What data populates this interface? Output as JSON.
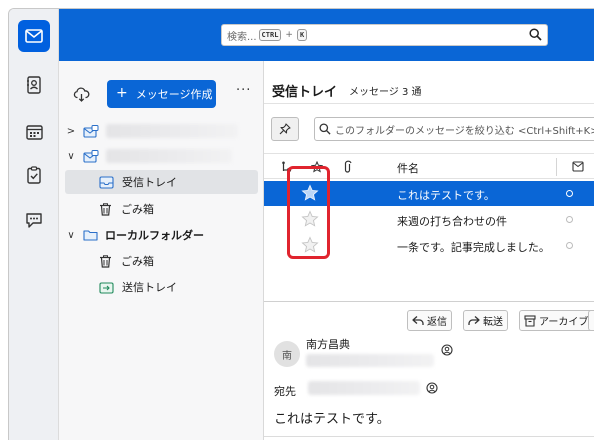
{
  "search": {
    "placeholder": "検索...",
    "key1": "CTRL",
    "plus": "+",
    "key2": "K"
  },
  "folder_pane": {
    "compose_label": "メッセージ作成",
    "folders": [
      {
        "label": "受信トレイ"
      },
      {
        "label": "ごみ箱"
      },
      {
        "label": "ローカルフォルダー"
      },
      {
        "label": "ごみ箱"
      },
      {
        "label": "送信トレイ"
      }
    ]
  },
  "message_list": {
    "title": "受信トレイ",
    "count": "メッセージ 3 通",
    "filter_placeholder": "このフォルダーのメッセージを絞り込む <Ctrl+Shift+K>",
    "subject_header": "件名",
    "rows": [
      {
        "subject": "これはテストです。",
        "selected": true
      },
      {
        "subject": "来週の打ち合わせの件",
        "selected": false
      },
      {
        "subject": "一条です。記事完成しました。",
        "selected": false
      }
    ]
  },
  "message_view": {
    "actions": [
      {
        "label": "返信"
      },
      {
        "label": "転送"
      },
      {
        "label": "アーカイブ"
      }
    ],
    "avatar_initial": "南",
    "sender_name": "南方昌典",
    "to_label": "宛先",
    "subject": "これはテストです。"
  },
  "colors": {
    "accent": "#0a66d6",
    "highlight_box": "#e0242e"
  }
}
